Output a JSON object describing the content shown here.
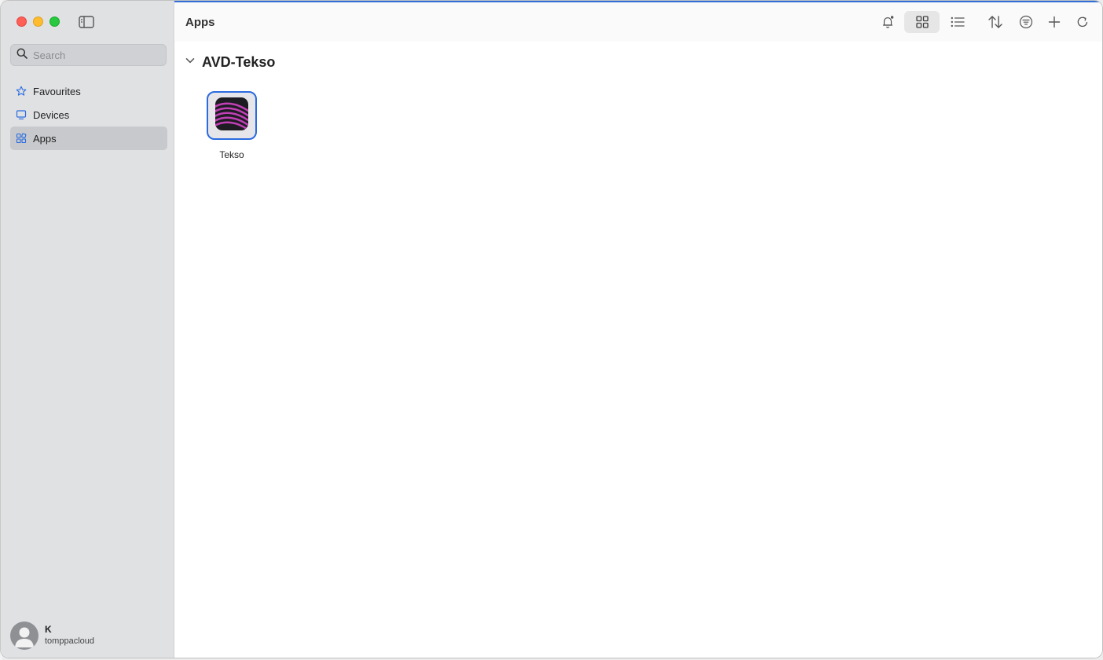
{
  "window": {
    "title": "Apps"
  },
  "sidebar": {
    "search": {
      "placeholder": "Search",
      "value": ""
    },
    "items": [
      {
        "label": "Favourites",
        "icon": "star-icon"
      },
      {
        "label": "Devices",
        "icon": "monitor-icon"
      },
      {
        "label": "Apps",
        "icon": "apps-grid-icon",
        "selected": true
      }
    ],
    "user": {
      "initial": "K",
      "account": "tomppacloud"
    }
  },
  "toolbar": {
    "buttons": [
      "bell-icon",
      "grid-view-icon",
      "list-view-icon",
      "sort-icon",
      "filter-icon",
      "plus-icon",
      "refresh-icon"
    ],
    "selected_view": "grid"
  },
  "groups": [
    {
      "name": "AVD-Tekso",
      "expanded": true,
      "apps": [
        {
          "label": "Tekso",
          "selected": true
        }
      ]
    }
  ],
  "colors": {
    "accent": "#2a6be0",
    "sidebar_bg": "#dfe1e3",
    "app_icon_bg": "#1c1c22",
    "app_icon_stripes": "#c23fb6"
  }
}
